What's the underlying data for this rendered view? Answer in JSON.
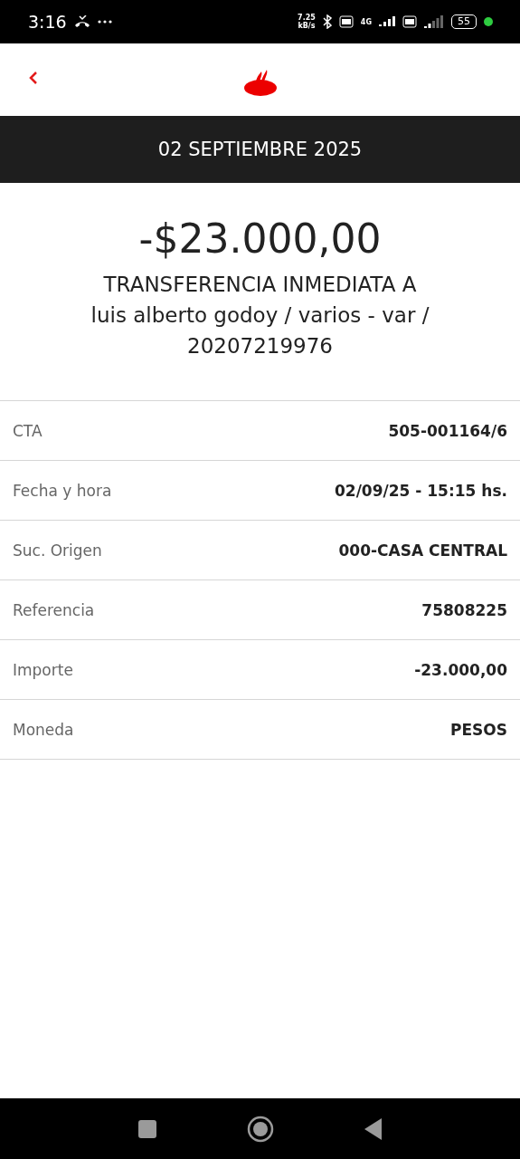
{
  "status_bar": {
    "time": "3:16",
    "net_speed": [
      "7.25",
      "kB/s"
    ],
    "network": "4G",
    "battery": "55"
  },
  "header": {
    "date": "02 SEPTIEMBRE 2025"
  },
  "transaction": {
    "amount": "-$23.000,00",
    "description": [
      "TRANSFERENCIA INMEDIATA A",
      "luis alberto godoy / varios - var /",
      "20207219976"
    ]
  },
  "details": [
    {
      "label": "CTA",
      "value": "505-001164/6"
    },
    {
      "label": "Fecha y hora",
      "value": "02/09/25 - 15:15 hs."
    },
    {
      "label": "Suc. Origen",
      "value": "000-CASA CENTRAL"
    },
    {
      "label": "Referencia",
      "value": "75808225"
    },
    {
      "label": "Importe",
      "value": "-23.000,00"
    },
    {
      "label": "Moneda",
      "value": "PESOS"
    }
  ]
}
